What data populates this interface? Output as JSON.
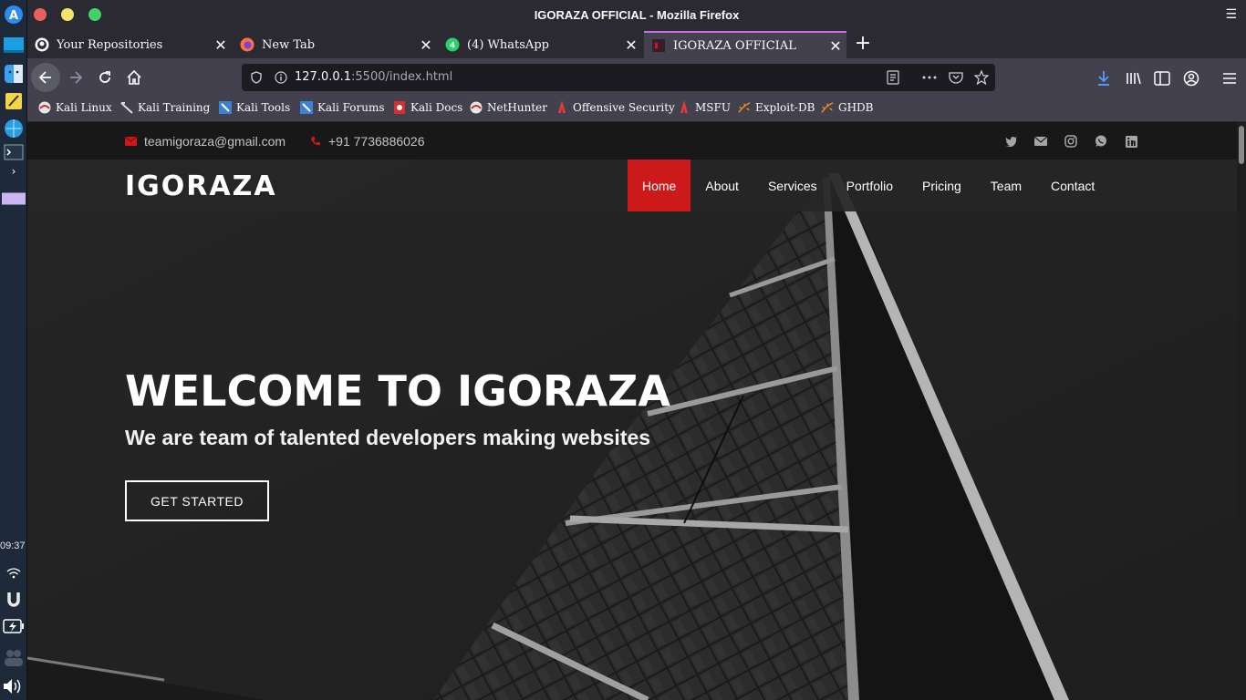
{
  "window": {
    "title": "IGORAZA OFFICIAL - Mozilla Firefox"
  },
  "dock": {
    "clock": "09:37"
  },
  "tabs": [
    {
      "label": "Your Repositories",
      "icon": "github-icon"
    },
    {
      "label": "New Tab",
      "icon": "firefox-icon"
    },
    {
      "label": "(4) WhatsApp",
      "icon": "whatsapp-icon"
    },
    {
      "label": "IGORAZA OFFICIAL",
      "icon": "site-icon",
      "active": true
    }
  ],
  "urlbar": {
    "host": "127.0.0.1",
    "path": ":5500/index.html"
  },
  "bookmarks": [
    {
      "label": "Kali Linux",
      "icon": "kali-icon"
    },
    {
      "label": "Kali Training",
      "icon": "kali-training-icon"
    },
    {
      "label": "Kali Tools",
      "icon": "kali-tools-icon"
    },
    {
      "label": "Kali Forums",
      "icon": "kali-forums-icon"
    },
    {
      "label": "Kali Docs",
      "icon": "kali-docs-icon"
    },
    {
      "label": "NetHunter",
      "icon": "nethunter-icon"
    },
    {
      "label": "Offensive Security",
      "icon": "offsec-icon"
    },
    {
      "label": "MSFU",
      "icon": "msfu-icon"
    },
    {
      "label": "Exploit-DB",
      "icon": "exploitdb-icon"
    },
    {
      "label": "GHDB",
      "icon": "ghdb-icon"
    }
  ],
  "site": {
    "email": "teamigoraza@gmail.com",
    "phone": "+91 7736886026",
    "logo": "IGORAZA",
    "menu": [
      "Home",
      "About",
      "Services",
      "Portfolio",
      "Pricing",
      "Team",
      "Contact"
    ],
    "active_menu": "Home",
    "hero_title": "WELCOME TO IGORAZA",
    "hero_subtitle": "We are team of talented developers making websites",
    "cta_label": "GET STARTED",
    "accent_color": "#cc1a1a",
    "social_icons": [
      "twitter-icon",
      "mail-icon",
      "instagram-icon",
      "whatsapp-icon",
      "linkedin-icon"
    ]
  }
}
